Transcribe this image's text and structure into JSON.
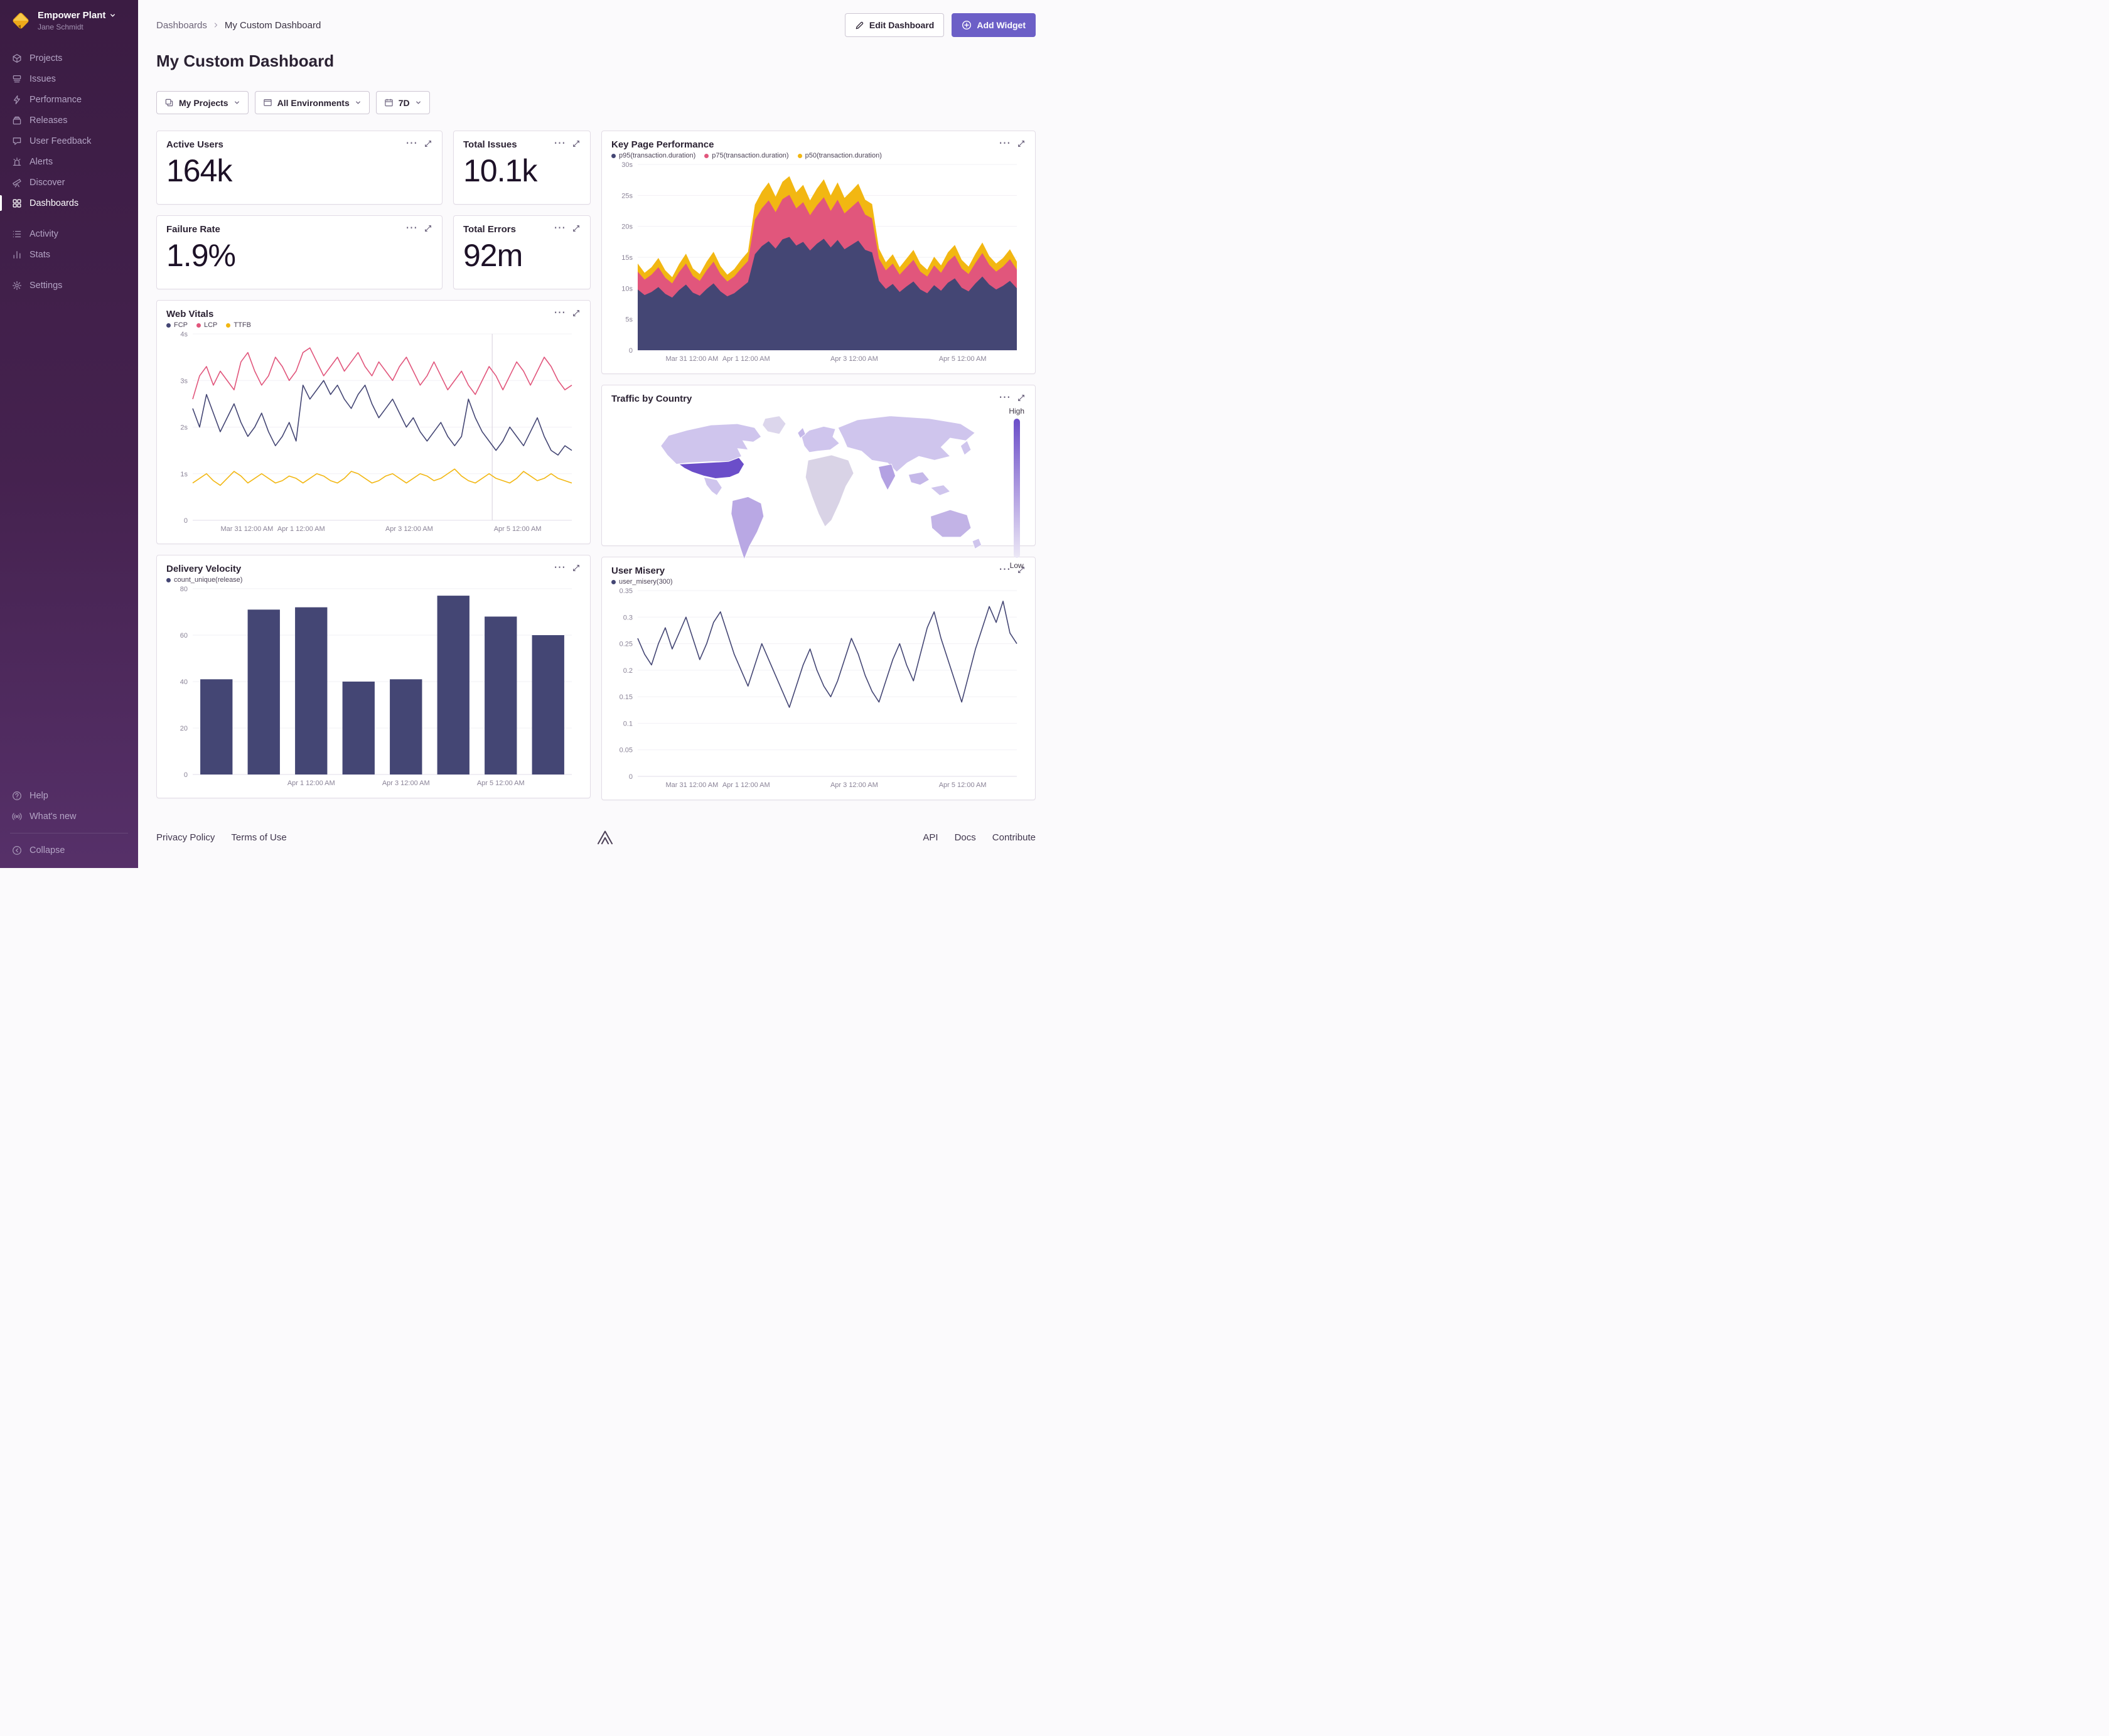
{
  "sidebar": {
    "org_name": "Empower Plant",
    "user_name": "Jane Schmidt",
    "nav": [
      {
        "label": "Projects"
      },
      {
        "label": "Issues"
      },
      {
        "label": "Performance"
      },
      {
        "label": "Releases"
      },
      {
        "label": "User Feedback"
      },
      {
        "label": "Alerts"
      },
      {
        "label": "Discover"
      },
      {
        "label": "Dashboards"
      }
    ],
    "nav2": [
      {
        "label": "Activity"
      },
      {
        "label": "Stats"
      }
    ],
    "settings_label": "Settings",
    "footer": [
      {
        "label": "Help"
      },
      {
        "label": "What's new"
      },
      {
        "label": "Collapse"
      }
    ]
  },
  "header": {
    "breadcrumb_root": "Dashboards",
    "breadcrumb_current": "My Custom Dashboard",
    "edit_button": "Edit Dashboard",
    "add_widget_button": "Add Widget",
    "page_title": "My Custom Dashboard"
  },
  "filters": {
    "projects": "My Projects",
    "environments": "All Environments",
    "date_range": "7D"
  },
  "stats": {
    "active_users": {
      "title": "Active Users",
      "value": "164k"
    },
    "total_issues": {
      "title": "Total Issues",
      "value": "10.1k"
    },
    "failure_rate": {
      "title": "Failure Rate",
      "value": "1.9%"
    },
    "total_errors": {
      "title": "Total Errors",
      "value": "92m"
    }
  },
  "map_widget": {
    "title": "Traffic by Country",
    "legend_high": "High",
    "legend_low": "Low"
  },
  "footer": {
    "privacy": "Privacy Policy",
    "terms": "Terms of Use",
    "api": "API",
    "docs": "Docs",
    "contribute": "Contribute"
  },
  "colors": {
    "accent_purple": "#6c5fc7",
    "chart_navy": "#444674",
    "chart_pink": "#e1567c",
    "chart_yellow": "#f2b712",
    "map_high": "#6b4ec9",
    "map_low": "#ece8f6"
  },
  "chart_data": [
    {
      "id": "key-page-performance",
      "type": "area",
      "stacked": true,
      "title": "Key Page Performance",
      "ylim": [
        0,
        30
      ],
      "yticks": [
        0,
        5,
        10,
        15,
        20,
        25,
        30
      ],
      "ytick_labels": [
        "0",
        "5s",
        "10s",
        "15s",
        "20s",
        "25s",
        "30s"
      ],
      "xtick_labels": [
        "Mar 31 12:00 AM",
        "Apr 1 12:00 AM",
        "Apr 3 12:00 AM",
        "Apr 5 12:00 AM"
      ],
      "xtick_pos": [
        0.143,
        0.286,
        0.571,
        0.857
      ],
      "series": [
        {
          "name": "p95(transaction.duration)",
          "color": "#444674",
          "values": [
            9.8,
            8.9,
            9.4,
            10.2,
            9.1,
            8.5,
            9.7,
            10.6,
            9.3,
            8.8,
            9.9,
            10.8,
            9.5,
            8.7,
            9.2,
            10.1,
            11.0,
            15.5,
            16.8,
            17.6,
            16.4,
            17.9,
            18.3,
            16.9,
            17.5,
            16.1,
            17.2,
            18.0,
            16.6,
            17.8,
            16.3,
            17.0,
            17.7,
            16.2,
            15.8,
            11.2,
            9.9,
            10.7,
            9.4,
            10.3,
            11.1,
            9.8,
            9.2,
            10.5,
            9.6,
            10.9,
            11.6,
            10.1,
            9.5,
            10.8,
            11.9,
            10.6,
            9.8,
            10.4,
            11.2,
            10.0
          ]
        },
        {
          "name": "p75(transaction.duration)",
          "color": "#e1567c",
          "values": [
            2.9,
            2.5,
            2.8,
            3.2,
            2.6,
            2.3,
            2.9,
            3.4,
            2.7,
            2.4,
            3.0,
            3.5,
            2.8,
            2.4,
            2.7,
            3.1,
            3.4,
            5.6,
            6.1,
            6.6,
            5.9,
            6.5,
            6.8,
            6.0,
            6.4,
            5.7,
            6.2,
            6.7,
            5.9,
            6.5,
            5.8,
            6.1,
            6.4,
            5.7,
            5.5,
            3.6,
            3.0,
            3.3,
            2.8,
            3.1,
            3.5,
            2.9,
            2.7,
            3.2,
            2.9,
            3.4,
            3.7,
            3.1,
            2.8,
            3.3,
            3.8,
            3.2,
            2.9,
            3.1,
            3.5,
            3.0
          ]
        },
        {
          "name": "p50(transaction.duration)",
          "color": "#f2b712",
          "values": [
            1.3,
            1.1,
            1.2,
            1.5,
            1.2,
            1.0,
            1.3,
            1.6,
            1.2,
            1.1,
            1.4,
            1.6,
            1.3,
            1.1,
            1.2,
            1.4,
            1.5,
            2.4,
            2.7,
            2.9,
            2.5,
            2.8,
            3.0,
            2.6,
            2.8,
            2.4,
            2.7,
            2.9,
            2.5,
            2.8,
            2.5,
            2.6,
            2.8,
            2.4,
            2.3,
            1.6,
            1.3,
            1.5,
            1.2,
            1.4,
            1.6,
            1.3,
            1.1,
            1.4,
            1.2,
            1.5,
            1.7,
            1.4,
            1.2,
            1.5,
            1.7,
            1.4,
            1.3,
            1.4,
            1.6,
            1.3
          ]
        }
      ]
    },
    {
      "id": "web-vitals",
      "type": "line",
      "title": "Web Vitals",
      "ylim": [
        0,
        4
      ],
      "yticks": [
        0,
        1,
        2,
        3,
        4
      ],
      "ytick_labels": [
        "0",
        "1s",
        "2s",
        "3s",
        "4s"
      ],
      "xtick_labels": [
        "Mar 31 12:00 AM",
        "Apr 1 12:00 AM",
        "Apr 3 12:00 AM",
        "Apr 5 12:00 AM"
      ],
      "xtick_pos": [
        0.143,
        0.286,
        0.571,
        0.857
      ],
      "vline": 0.79,
      "series": [
        {
          "name": "FCP",
          "color": "#444674",
          "values": [
            2.4,
            2.0,
            2.7,
            2.3,
            1.9,
            2.2,
            2.5,
            2.1,
            1.8,
            2.0,
            2.3,
            1.9,
            1.6,
            1.8,
            2.1,
            1.7,
            2.9,
            2.6,
            2.8,
            3.0,
            2.7,
            2.9,
            2.6,
            2.4,
            2.7,
            2.9,
            2.5,
            2.2,
            2.4,
            2.6,
            2.3,
            2.0,
            2.2,
            1.9,
            1.7,
            1.9,
            2.1,
            1.8,
            1.6,
            1.8,
            2.6,
            2.2,
            1.9,
            1.7,
            1.5,
            1.7,
            2.0,
            1.8,
            1.6,
            1.9,
            2.2,
            1.8,
            1.5,
            1.4,
            1.6,
            1.5
          ]
        },
        {
          "name": "LCP",
          "color": "#e1567c",
          "values": [
            2.6,
            3.1,
            3.3,
            2.9,
            3.2,
            3.0,
            2.8,
            3.4,
            3.6,
            3.2,
            2.9,
            3.1,
            3.5,
            3.3,
            3.0,
            3.2,
            3.6,
            3.7,
            3.4,
            3.1,
            3.3,
            3.5,
            3.2,
            3.4,
            3.6,
            3.3,
            3.1,
            3.4,
            3.2,
            3.0,
            3.3,
            3.5,
            3.2,
            2.9,
            3.1,
            3.4,
            3.1,
            2.8,
            3.0,
            3.2,
            2.9,
            2.7,
            3.0,
            3.3,
            3.1,
            2.8,
            3.1,
            3.4,
            3.2,
            2.9,
            3.2,
            3.5,
            3.3,
            3.0,
            2.8,
            2.9
          ]
        },
        {
          "name": "TTFB",
          "color": "#f2b712",
          "values": [
            0.8,
            0.9,
            1.0,
            0.85,
            0.75,
            0.9,
            1.05,
            0.95,
            0.8,
            0.9,
            1.0,
            0.9,
            0.8,
            0.85,
            0.95,
            0.9,
            0.8,
            0.9,
            1.0,
            0.95,
            0.85,
            0.8,
            0.9,
            1.05,
            1.0,
            0.9,
            0.8,
            0.85,
            0.95,
            1.0,
            0.9,
            0.8,
            0.9,
            1.0,
            0.95,
            0.85,
            0.9,
            1.0,
            1.1,
            0.95,
            0.85,
            0.8,
            0.9,
            1.0,
            0.9,
            0.85,
            0.8,
            0.9,
            1.05,
            0.95,
            0.85,
            0.9,
            1.0,
            0.9,
            0.85,
            0.8
          ]
        }
      ]
    },
    {
      "id": "delivery-velocity",
      "type": "bar",
      "title": "Delivery Velocity",
      "ylim": [
        0,
        80
      ],
      "yticks": [
        0,
        20,
        40,
        60,
        80
      ],
      "ytick_labels": [
        "0",
        "20",
        "40",
        "60",
        "80"
      ],
      "xtick_labels": [
        "Apr 1 12:00 AM",
        "Apr 3 12:00 AM",
        "Apr 5 12:00 AM"
      ],
      "xtick_pos": [
        0.3125,
        0.5625,
        0.8125
      ],
      "series": [
        {
          "name": "count_unique(release)",
          "color": "#444674",
          "values": [
            41,
            71,
            72,
            40,
            41,
            77,
            68,
            60
          ]
        }
      ]
    },
    {
      "id": "user-misery",
      "type": "line",
      "title": "User Misery",
      "ylim": [
        0,
        0.35
      ],
      "yticks": [
        0,
        0.05,
        0.1,
        0.15,
        0.2,
        0.25,
        0.3,
        0.35
      ],
      "ytick_labels": [
        "0",
        "0.05",
        "0.1",
        "0.15",
        "0.2",
        "0.25",
        "0.3",
        "0.35"
      ],
      "xtick_labels": [
        "Mar 31 12:00 AM",
        "Apr 1 12:00 AM",
        "Apr 3 12:00 AM",
        "Apr 5 12:00 AM"
      ],
      "xtick_pos": [
        0.143,
        0.286,
        0.571,
        0.857
      ],
      "series": [
        {
          "name": "user_misery(300)",
          "color": "#444674",
          "values": [
            0.26,
            0.23,
            0.21,
            0.25,
            0.28,
            0.24,
            0.27,
            0.3,
            0.26,
            0.22,
            0.25,
            0.29,
            0.31,
            0.27,
            0.23,
            0.2,
            0.17,
            0.21,
            0.25,
            0.22,
            0.19,
            0.16,
            0.13,
            0.17,
            0.21,
            0.24,
            0.2,
            0.17,
            0.15,
            0.18,
            0.22,
            0.26,
            0.23,
            0.19,
            0.16,
            0.14,
            0.18,
            0.22,
            0.25,
            0.21,
            0.18,
            0.23,
            0.28,
            0.31,
            0.26,
            0.22,
            0.18,
            0.14,
            0.19,
            0.24,
            0.28,
            0.32,
            0.29,
            0.33,
            0.27,
            0.25
          ]
        }
      ]
    }
  ]
}
